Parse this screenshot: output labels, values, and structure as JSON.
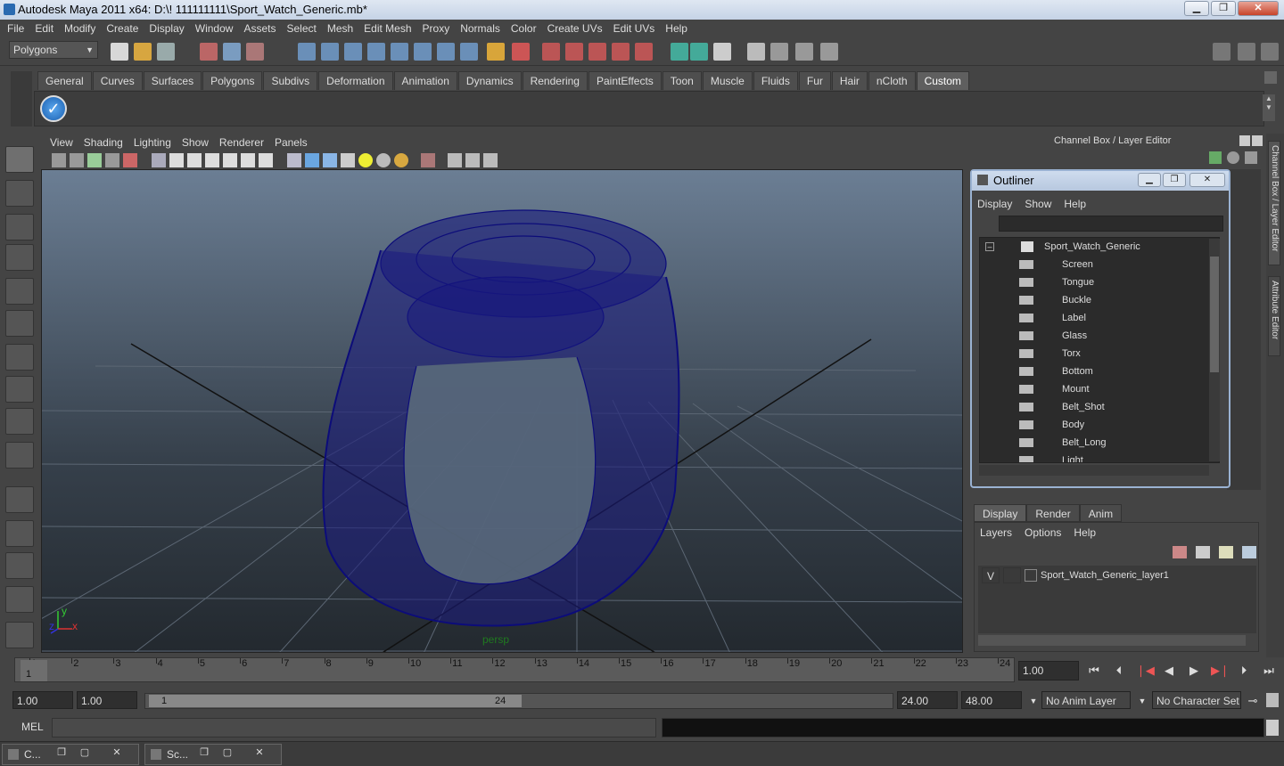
{
  "window": {
    "title": "Autodesk Maya 2011 x64: D:\\! 111111111\\Sport_Watch_Generic.mb*",
    "min": "▁",
    "max": "❐",
    "close": "✕"
  },
  "menubar": [
    "File",
    "Edit",
    "Modify",
    "Create",
    "Display",
    "Window",
    "Assets",
    "Select",
    "Mesh",
    "Edit Mesh",
    "Proxy",
    "Normals",
    "Color",
    "Create UVs",
    "Edit UVs",
    "Help"
  ],
  "status": {
    "mode": "Polygons"
  },
  "shelf": {
    "tabs": [
      "General",
      "Curves",
      "Surfaces",
      "Polygons",
      "Subdivs",
      "Deformation",
      "Animation",
      "Dynamics",
      "Rendering",
      "PaintEffects",
      "Toon",
      "Muscle",
      "Fluids",
      "Fur",
      "Hair",
      "nCloth",
      "Custom"
    ],
    "active": "Custom"
  },
  "viewport": {
    "menu": [
      "View",
      "Shading",
      "Lighting",
      "Show",
      "Renderer",
      "Panels"
    ],
    "camera_label": "persp",
    "axis": {
      "y": "y",
      "x": "x",
      "z": "z"
    }
  },
  "right": {
    "header": "Channel Box / Layer Editor",
    "side_tabs": [
      "Channel Box / Layer Editor",
      "Attribute Editor"
    ]
  },
  "outliner": {
    "title": "Outliner",
    "menu": [
      "Display",
      "Show",
      "Help"
    ],
    "root": "Sport_Watch_Generic",
    "children": [
      "Screen",
      "Tongue",
      "Buckle",
      "Label",
      "Glass",
      "Torx",
      "Bottom",
      "Mount",
      "Belt_Shot",
      "Body",
      "Belt_Long",
      "Light"
    ]
  },
  "layers": {
    "tabs": [
      "Display",
      "Render",
      "Anim"
    ],
    "active": "Display",
    "menu": [
      "Layers",
      "Options",
      "Help"
    ],
    "rows": [
      {
        "visible": "V",
        "name": "Sport_Watch_Generic_layer1"
      }
    ]
  },
  "timeline": {
    "ticks": [
      "1",
      "2",
      "3",
      "4",
      "5",
      "6",
      "7",
      "8",
      "9",
      "10",
      "11",
      "12",
      "13",
      "14",
      "15",
      "16",
      "17",
      "18",
      "19",
      "20",
      "21",
      "22",
      "23",
      "24"
    ],
    "current_frame": "1",
    "current_field": "1.00"
  },
  "range": {
    "start": "1.00",
    "start2": "1.00",
    "slider_start": "1",
    "slider_end": "24",
    "end": "24.00",
    "end2": "48.00",
    "anim_layer": "No Anim Layer",
    "char_set": "No Character Set"
  },
  "cmd": {
    "label": "MEL"
  },
  "taskbar": [
    {
      "label": "C..."
    },
    {
      "label": "Sc..."
    }
  ],
  "colors": {
    "wire": "#0c0c7a",
    "grid": "#5c6774",
    "accent": "#9ab2d2"
  }
}
